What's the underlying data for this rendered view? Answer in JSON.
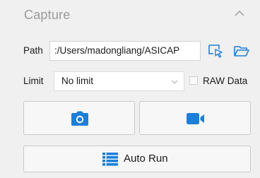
{
  "section": {
    "title": "Capture",
    "collapse_icon": "chevron-up-icon"
  },
  "path": {
    "label": "Path",
    "value": ":/Users/madongliang/ASICAP",
    "select_icon": "cursor-select-icon",
    "open_folder_icon": "folder-open-icon"
  },
  "limit": {
    "label": "Limit",
    "selected": "No limit",
    "raw_data_label": "RAW Data",
    "raw_data_checked": false
  },
  "buttons": {
    "snapshot_icon": "camera-icon",
    "record_icon": "video-camera-icon",
    "auto_run_label": "Auto Run",
    "auto_run_icon": "list-icon"
  },
  "colors": {
    "accent": "#1e7fd8",
    "title": "#9a9a9a",
    "background": "#f0f0f0"
  }
}
